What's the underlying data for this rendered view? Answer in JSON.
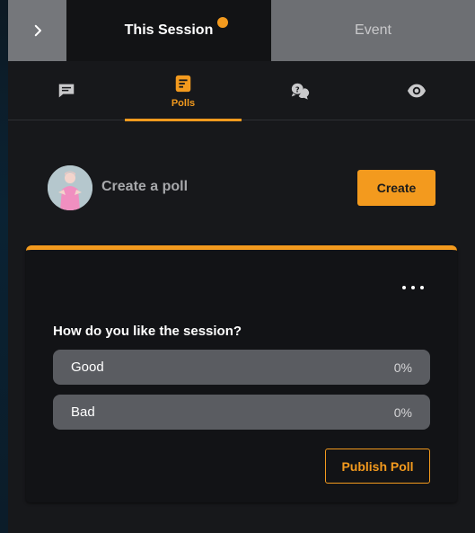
{
  "session_tabs": {
    "collapse_icon": "chevron-right-icon",
    "active": "This Session",
    "inactive": "Event",
    "notification_color": "#f39a1e"
  },
  "icon_tabs": [
    {
      "icon": "chat-icon",
      "label": ""
    },
    {
      "icon": "poll-icon",
      "label": "Polls",
      "active": true
    },
    {
      "icon": "qa-icon",
      "label": ""
    },
    {
      "icon": "eye-icon",
      "label": ""
    }
  ],
  "create": {
    "avatar_icon": "user-avatar",
    "label": "Create a poll",
    "button": "Create"
  },
  "poll": {
    "menu_icon": "more-horizontal-icon",
    "question": "How do you like the session?",
    "options": [
      {
        "label": "Good",
        "percent": "0%"
      },
      {
        "label": "Bad",
        "percent": "0%"
      }
    ],
    "publish": "Publish Poll"
  },
  "colors": {
    "accent": "#f39a1e",
    "background": "#17181b",
    "card": "#121316",
    "option": "#5a5c61"
  }
}
